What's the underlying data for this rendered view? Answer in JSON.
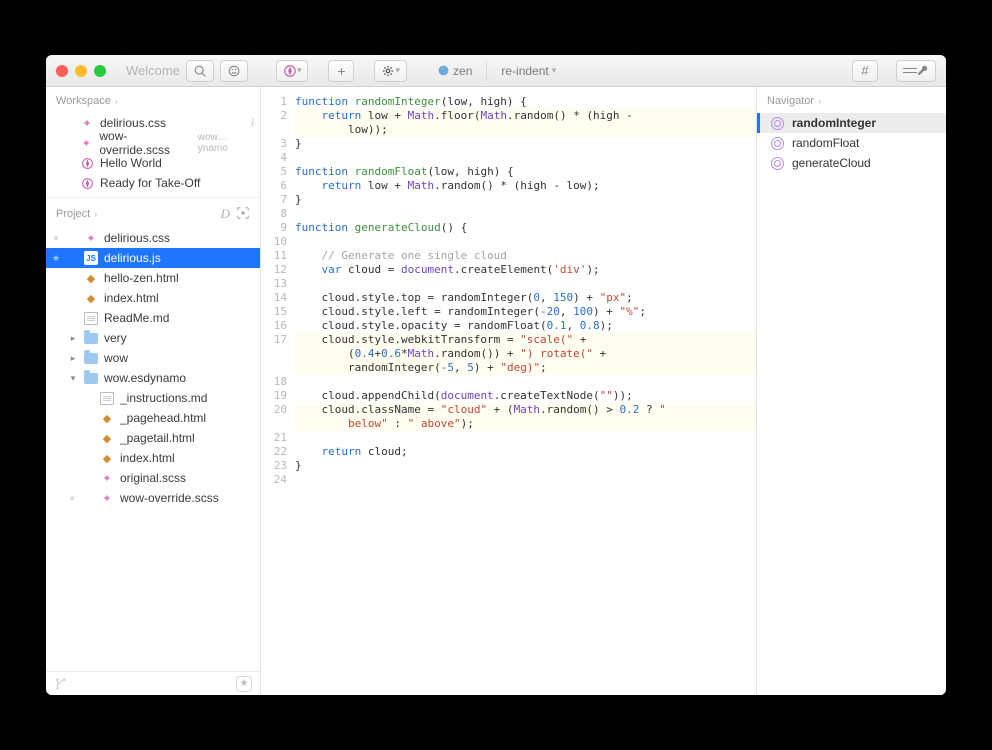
{
  "titlebar": {
    "title": "Welcome",
    "zen_label": "zen",
    "reindent_label": "re-indent"
  },
  "sidebar": {
    "workspace_label": "Workspace",
    "project_label": "Project",
    "workspace_items": [
      {
        "name": "delirious.css",
        "icon": "css",
        "badge": "/"
      },
      {
        "name": "wow-override.scss",
        "icon": "css",
        "badge": "wow…ynamo"
      },
      {
        "name": "Hello World",
        "icon": "comp",
        "badge": ""
      },
      {
        "name": "Ready for Take-Off",
        "icon": "comp",
        "badge": ""
      }
    ],
    "project_tree": [
      {
        "name": "delirious.css",
        "icon": "css",
        "type": "file",
        "star": true
      },
      {
        "name": "delirious.js",
        "icon": "js",
        "type": "file",
        "star": true,
        "selected": true
      },
      {
        "name": "hello-zen.html",
        "icon": "html",
        "type": "file"
      },
      {
        "name": "index.html",
        "icon": "html",
        "type": "file"
      },
      {
        "name": "ReadMe.md",
        "icon": "md",
        "type": "file"
      },
      {
        "name": "very",
        "icon": "folder",
        "type": "folder",
        "open": false
      },
      {
        "name": "wow",
        "icon": "folder",
        "type": "folder",
        "open": false
      },
      {
        "name": "wow.esdynamo",
        "icon": "folder",
        "type": "folder",
        "open": true,
        "children": [
          {
            "name": "_instructions.md",
            "icon": "md"
          },
          {
            "name": "_pagehead.html",
            "icon": "html"
          },
          {
            "name": "_pagetail.html",
            "icon": "html"
          },
          {
            "name": "index.html",
            "icon": "html"
          },
          {
            "name": "original.scss",
            "icon": "css"
          },
          {
            "name": "wow-override.scss",
            "icon": "css",
            "star": true
          }
        ]
      }
    ]
  },
  "navigator": {
    "label": "Navigator",
    "items": [
      {
        "name": "randomInteger",
        "selected": true
      },
      {
        "name": "randomFloat"
      },
      {
        "name": "generateCloud"
      }
    ]
  },
  "code": {
    "lines": [
      {
        "n": 1,
        "html": "<span class='kw'>function</span> <span class='fn'>randomInteger</span>(low, high) {"
      },
      {
        "n": 2,
        "html": "    <span class='kw'>return</span> low + <span class='obj'>Math</span>.floor(<span class='obj'>Math</span>.random() * (high -",
        "wrap": true
      },
      {
        "n": "",
        "html": "        low));",
        "wrap": true
      },
      {
        "n": 3,
        "html": "}"
      },
      {
        "n": 4,
        "html": ""
      },
      {
        "n": 5,
        "html": "<span class='kw'>function</span> <span class='fn'>randomFloat</span>(low, high) {"
      },
      {
        "n": 6,
        "html": "    <span class='kw'>return</span> low + <span class='obj'>Math</span>.random() * (high - low);"
      },
      {
        "n": 7,
        "html": "}"
      },
      {
        "n": 8,
        "html": ""
      },
      {
        "n": 9,
        "html": "<span class='kw'>function</span> <span class='fn'>generateCloud</span>() {"
      },
      {
        "n": 10,
        "html": ""
      },
      {
        "n": 11,
        "html": "    <span class='cm'>// Generate one single cloud</span>"
      },
      {
        "n": 12,
        "html": "    <span class='kw'>var</span> cloud = <span class='obj'>document</span>.createElement(<span class='str'>'div'</span>);"
      },
      {
        "n": 13,
        "html": ""
      },
      {
        "n": 14,
        "html": "    cloud.style.top = randomInteger(<span class='num'>0</span>, <span class='num'>150</span>) + <span class='str'>\"px\"</span>;"
      },
      {
        "n": 15,
        "html": "    cloud.style.left = randomInteger(<span class='num'>-20</span>, <span class='num'>100</span>) + <span class='str'>\"%\"</span>;"
      },
      {
        "n": 16,
        "html": "    cloud.style.opacity = randomFloat(<span class='num'>0.1</span>, <span class='num'>0.8</span>);"
      },
      {
        "n": 17,
        "html": "    cloud.style.webkitTransform = <span class='str'>\"scale(\"</span> +",
        "wrap": true
      },
      {
        "n": "",
        "html": "        (<span class='num'>0.4</span>+<span class='num'>0.6</span>*<span class='obj'>Math</span>.random()) + <span class='str'>\") rotate(\"</span> +",
        "wrap": true
      },
      {
        "n": "",
        "html": "        randomInteger(<span class='num'>-5</span>, <span class='num'>5</span>) + <span class='str'>\"deg)\"</span>;",
        "wrap": true
      },
      {
        "n": 18,
        "html": ""
      },
      {
        "n": 19,
        "html": "    cloud.appendChild(<span class='obj'>document</span>.createTextNode(<span class='str'>\"\"</span>));"
      },
      {
        "n": 20,
        "html": "    cloud.className = <span class='str'>\"cloud\"</span> + (<span class='obj'>Math</span>.random() > <span class='num'>0.2</span> ? <span class='str'>\"</span>",
        "wrap": true
      },
      {
        "n": "",
        "html": "<span class='str'>        below\"</span> : <span class='str'>\" above\"</span>);",
        "wrap": true
      },
      {
        "n": 21,
        "html": ""
      },
      {
        "n": 22,
        "html": "    <span class='kw'>return</span> cloud;"
      },
      {
        "n": 23,
        "html": "}"
      },
      {
        "n": 24,
        "html": ""
      }
    ]
  }
}
